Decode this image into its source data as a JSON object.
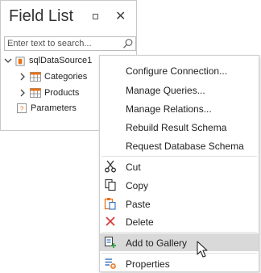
{
  "field_list": {
    "title": "Field List",
    "search_placeholder": "Enter text to search...",
    "tree": {
      "root": "sqlDataSource1",
      "children": [
        "Categories",
        "Products"
      ],
      "parameters": "Parameters"
    }
  },
  "context_menu": {
    "items": [
      {
        "label": "Configure Connection...",
        "icon": ""
      },
      {
        "label": "Manage Queries...",
        "icon": ""
      },
      {
        "label": "Manage Relations...",
        "icon": ""
      },
      {
        "label": "Rebuild Result Schema",
        "icon": ""
      },
      {
        "label": "Request Database Schema",
        "icon": ""
      },
      {
        "label": "Cut",
        "icon": "scissors-icon"
      },
      {
        "label": "Copy",
        "icon": "copy-icon"
      },
      {
        "label": "Paste",
        "icon": "paste-icon"
      },
      {
        "label": "Delete",
        "icon": "delete-x-icon"
      },
      {
        "label": "Add to Gallery",
        "icon": "add-to-gallery-icon",
        "highlighted": true
      },
      {
        "label": "Properties",
        "icon": "properties-icon"
      }
    ]
  },
  "colors": {
    "highlight": "#d9d9d9",
    "delete_red": "#d83b3b",
    "orange": "#e8731b",
    "blue": "#2e6fc1"
  }
}
